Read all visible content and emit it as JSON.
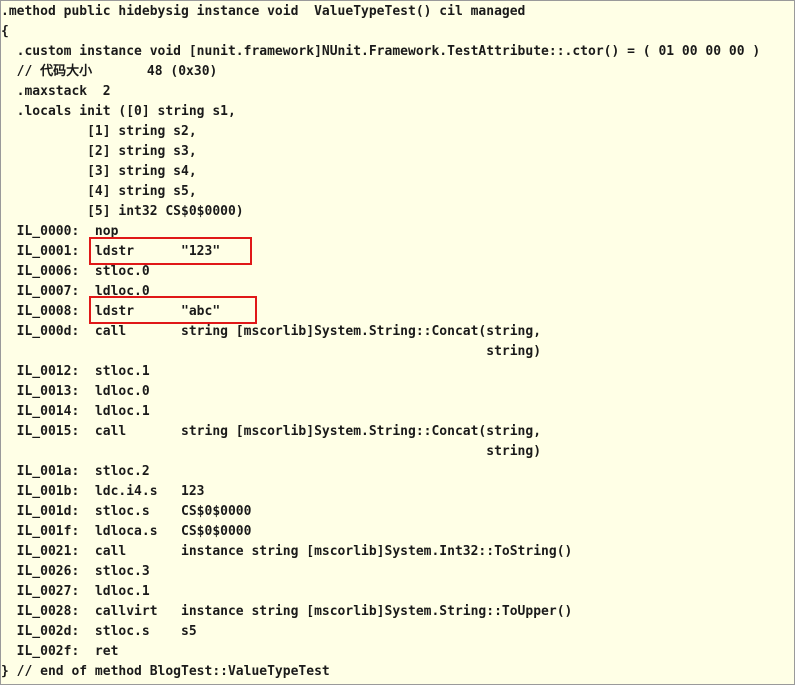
{
  "code": {
    "lines": [
      ".method public hidebysig instance void  ValueTypeTest() cil managed",
      "{",
      "  .custom instance void [nunit.framework]NUnit.Framework.TestAttribute::.ctor() = ( 01 00 00 00 )",
      "  // 代码大小       48 (0x30)",
      "  .maxstack  2",
      "  .locals init ([0] string s1,",
      "           [1] string s2,",
      "           [2] string s3,",
      "           [3] string s4,",
      "           [4] string s5,",
      "           [5] int32 CS$0$0000)",
      "  IL_0000:  nop",
      "  IL_0001:  ldstr      \"123\"",
      "  IL_0006:  stloc.0",
      "  IL_0007:  ldloc.0",
      "  IL_0008:  ldstr      \"abc\"",
      "  IL_000d:  call       string [mscorlib]System.String::Concat(string,",
      "                                                              string)",
      "  IL_0012:  stloc.1",
      "  IL_0013:  ldloc.0",
      "  IL_0014:  ldloc.1",
      "  IL_0015:  call       string [mscorlib]System.String::Concat(string,",
      "                                                              string)",
      "  IL_001a:  stloc.2",
      "  IL_001b:  ldc.i4.s   123",
      "  IL_001d:  stloc.s    CS$0$0000",
      "  IL_001f:  ldloca.s   CS$0$0000",
      "  IL_0021:  call       instance string [mscorlib]System.Int32::ToString()",
      "  IL_0026:  stloc.3",
      "  IL_0027:  ldloc.1",
      "  IL_0028:  callvirt   instance string [mscorlib]System.String::ToUpper()",
      "  IL_002d:  stloc.s    s5",
      "  IL_002f:  ret",
      "} // end of method BlogTest::ValueTypeTest"
    ]
  },
  "highlight_color": "#e01818"
}
